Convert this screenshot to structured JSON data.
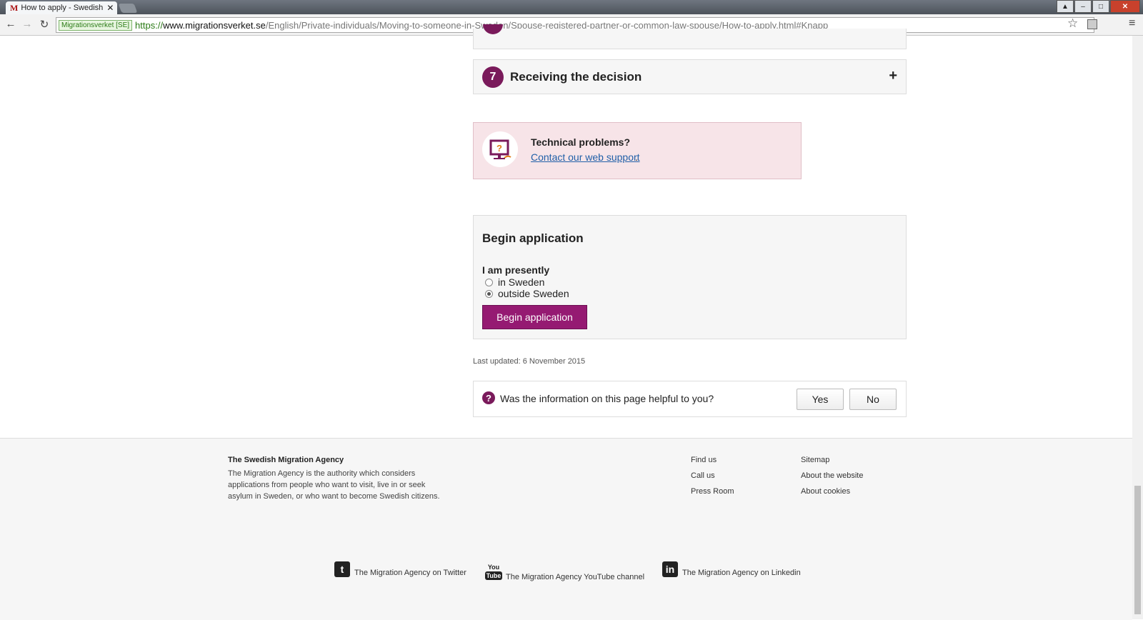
{
  "browser": {
    "tab_title": "How to apply - Swedish M",
    "tab_favicon": "M",
    "close_glyph": "✕",
    "secure_badge": "Migrationsverket [SE]",
    "url_proto": "https://",
    "url_host": "www.migrationsverket.se",
    "url_path": "/English/Private-individuals/Moving-to-someone-in-Sweden/Spouse-registered-partner-or-common-law-spouse/How-to-apply.html#Knapp",
    "back_glyph": "←",
    "forward_glyph": "→",
    "reload_glyph": "↻",
    "star_glyph": "☆",
    "menu_glyph": "≡"
  },
  "accordion": {
    "step7_number": "7",
    "step7_title": "Receiving the decision",
    "expand_glyph": "+"
  },
  "tech_problems": {
    "title": "Technical problems?",
    "link": "Contact our web support",
    "link_suffix": "."
  },
  "begin_application": {
    "heading": "Begin application",
    "question": "I am presently",
    "options": [
      {
        "label": "in Sweden",
        "selected": false
      },
      {
        "label": "outside Sweden",
        "selected": true
      }
    ],
    "button": "Begin application"
  },
  "last_updated": "Last updated: 6 November 2015",
  "helpful": {
    "icon_glyph": "?",
    "question": "Was the information on this page helpful to you?",
    "yes": "Yes",
    "no": "No"
  },
  "footer": {
    "org_title": "The Swedish Migration Agency",
    "org_desc": "The Migration Agency is the authority which considers applications from people who want to visit, live in or seek asylum in Sweden, or who want to become Swedish citizens.",
    "col1": [
      "Find us",
      "Call us",
      "Press Room"
    ],
    "col2": [
      "Sitemap",
      "About the website",
      "About cookies"
    ],
    "social": {
      "twitter": "The Migration Agency on Twitter",
      "youtube": "The Migration Agency YouTube channel",
      "linkedin": "The Migration Agency on Linkedin"
    }
  },
  "colors": {
    "brand_purple": "#7a1a5b",
    "button_purple": "#951a72",
    "tech_bg": "#f7e4e8",
    "link_blue": "#2160a8"
  }
}
